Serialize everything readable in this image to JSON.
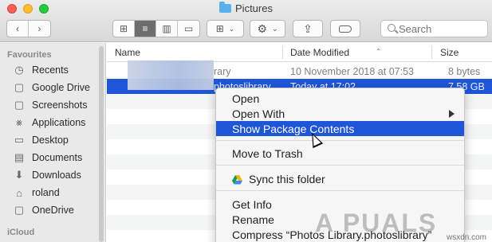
{
  "window": {
    "title": "Pictures"
  },
  "toolbar": {
    "search_placeholder": "Search"
  },
  "sidebar": {
    "section_favourites": "Favourites",
    "items": [
      {
        "label": "Recents",
        "icon": "clock-icon"
      },
      {
        "label": "Google Drive",
        "icon": "folder-icon"
      },
      {
        "label": "Screenshots",
        "icon": "folder-icon"
      },
      {
        "label": "Applications",
        "icon": "applications-icon"
      },
      {
        "label": "Desktop",
        "icon": "desktop-icon"
      },
      {
        "label": "Documents",
        "icon": "document-icon"
      },
      {
        "label": "Downloads",
        "icon": "download-icon"
      },
      {
        "label": "roland",
        "icon": "home-icon"
      },
      {
        "label": "OneDrive",
        "icon": "folder-icon"
      }
    ],
    "section_icloud": "iCloud"
  },
  "list": {
    "headers": {
      "name": "Name",
      "date": "Date Modified",
      "size": "Size"
    },
    "rows": [
      {
        "name": "rary",
        "date": "10 November 2018 at 07:53",
        "size": "8 bytes"
      },
      {
        "name": "photoslibrary",
        "date": "Today at 17:02",
        "size": "7.58 GB"
      }
    ]
  },
  "context_menu": {
    "items": [
      {
        "label": "Open"
      },
      {
        "label": "Open With"
      },
      {
        "label": "Show Package Contents"
      },
      {
        "label": "Move to Trash"
      },
      {
        "label": "Sync this folder"
      },
      {
        "label": "Get Info"
      },
      {
        "label": "Rename"
      },
      {
        "label": "Compress “Photos Library.photoslibrary”"
      }
    ]
  },
  "watermark": "A PUALS",
  "site": "wsxdn.com",
  "colors": {
    "selection": "#1e56d7",
    "sidebar_bg": "#e9e9ea"
  }
}
